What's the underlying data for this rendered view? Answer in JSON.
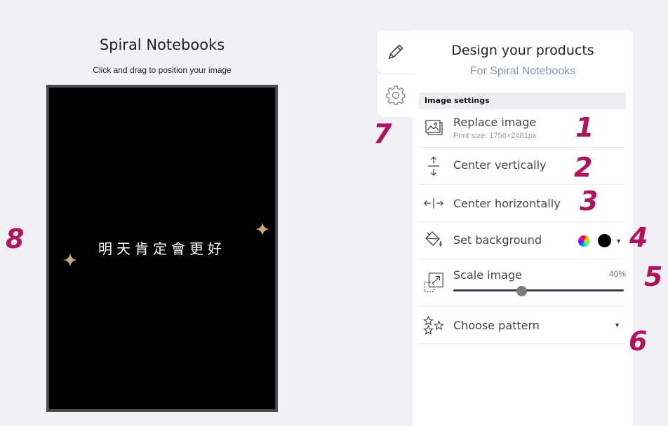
{
  "preview": {
    "title": "Spiral Notebooks",
    "hint": "Click and drag to position your image",
    "canvas_text": "明天肯定會更好"
  },
  "tabs": [
    {
      "icon": "pencil-icon",
      "active": true
    },
    {
      "icon": "gear-icon",
      "active": false
    }
  ],
  "panel": {
    "title": "Design your products",
    "subtitle": "For Spiral Notebooks",
    "section_header": "Image settings",
    "replace": {
      "label": "Replace image",
      "sub": "Print size: 1756×2481px"
    },
    "center_vertically": {
      "label": "Center vertically"
    },
    "center_horizontally": {
      "label": "Center horizontally"
    },
    "background": {
      "label": "Set background",
      "color": "#000000"
    },
    "scale": {
      "label": "Scale image",
      "value_text": "40%",
      "value": 40
    },
    "pattern": {
      "label": "Choose pattern"
    }
  },
  "annotations": [
    "1",
    "2",
    "3",
    "4",
    "5",
    "6",
    "7",
    "8"
  ],
  "colors": {
    "accent_annotation": "#b3125d",
    "subtitle": "#8a95a6",
    "canvas_background": "#000000"
  }
}
